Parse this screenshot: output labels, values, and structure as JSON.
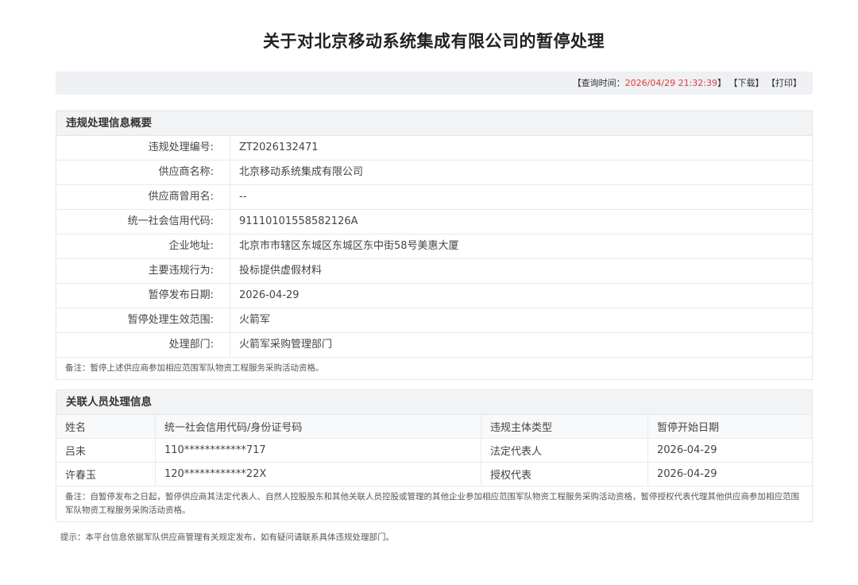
{
  "page": {
    "title": "关于对北京移动系统集成有限公司的暂停处理"
  },
  "query_bar": {
    "time_prefix": "【查询时间：",
    "time_value": "2026/04/29 21:32:39",
    "time_suffix": "】",
    "download_label": "【下载】",
    "print_label": "【打印】"
  },
  "summary": {
    "heading": "违规处理信息概要",
    "rows": [
      {
        "label": "违规处理编号:",
        "value": "ZT2026132471"
      },
      {
        "label": "供应商名称:",
        "value": "北京移动系统集成有限公司"
      },
      {
        "label": "供应商曾用名:",
        "value": "--"
      },
      {
        "label": "统一社会信用代码:",
        "value": "91110101558582126A"
      },
      {
        "label": "企业地址:",
        "value": "北京市市辖区东城区东城区东中街58号美惠大厦"
      },
      {
        "label": "主要违规行为:",
        "value": "投标提供虚假材料"
      },
      {
        "label": "暂停发布日期:",
        "value": "2026-04-29"
      },
      {
        "label": "暂停处理生效范围:",
        "value": "火箭军"
      },
      {
        "label": "处理部门:",
        "value": "火箭军采购管理部门"
      }
    ],
    "note": "备注：暂停上述供应商参加相应范围军队物资工程服务采购活动资格。"
  },
  "persons": {
    "heading": "关联人员处理信息",
    "columns": [
      "姓名",
      "统一社会信用代码/身份证号码",
      "违规主体类型",
      "暂停开始日期"
    ],
    "rows": [
      {
        "name": "吕未",
        "id": "110************717",
        "type": "法定代表人",
        "date": "2026-04-29"
      },
      {
        "name": "许春玉",
        "id": "120************22X",
        "type": "授权代表",
        "date": "2026-04-29"
      }
    ],
    "note": "备注：自暂停发布之日起，暂停供应商其法定代表人、自然人控股股东和其他关联人员控股或管理的其他企业参加相应范围军队物资工程服务采购活动资格，暂停授权代表代理其他供应商参加相应范围军队物资工程服务采购活动资格。"
  },
  "footer": {
    "hint": "提示：本平台信息依据军队供应商管理有关规定发布，如有疑问请联系具体违规处理部门。"
  },
  "colors": {
    "accent_time": "#e2383d",
    "bar_bg": "#eef0f3",
    "panel_head_bg": "#f2f3f5"
  }
}
